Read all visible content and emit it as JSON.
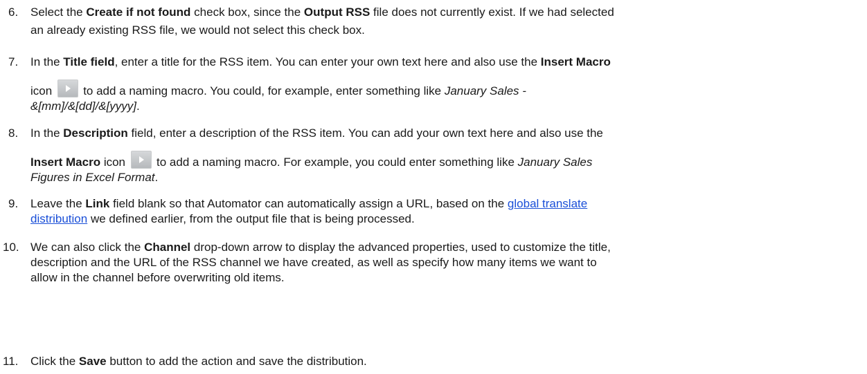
{
  "steps": [
    {
      "number": "6.",
      "t1": "Select the ",
      "b1": "Create if not found",
      "t2": " check box, since the ",
      "b2": "Output RSS",
      "t3": " file does not currently exist. If we had selected",
      "t4": "an already existing RSS file, we would not select this check box."
    },
    {
      "number": "7.",
      "t1": "In the ",
      "b1": "Title field",
      "t2": ", enter a title for the RSS item. You can enter your own text here and also use the ",
      "b2": "Insert Macro",
      "t3": "icon",
      "t4": "to add a naming macro. You could, for example, enter something like ",
      "i1": "January Sales -",
      "i2": "&[mm]/&[dd]/&[yyyy]",
      "t5": "."
    },
    {
      "number": "8.",
      "t1": "In the ",
      "b1": "Description",
      "t2": " field, enter a description of the RSS item. You can add your own text here and also use the",
      "b2": "Insert Macro",
      "t3": " icon",
      "t4": "to add a naming macro. For example, you could enter something like ",
      "i1": "January Sales",
      "i2": "Figures in Excel Format",
      "t5": "."
    },
    {
      "number": "9.",
      "t1": "Leave the ",
      "b1": "Link",
      "t2": " field blank so that Automator can automatically assign a URL, based on the ",
      "link1": "global translate",
      "link2": "distribution",
      "t3": " we defined earlier, from the output file that is being processed."
    },
    {
      "number": "10.",
      "t1": "We can also click the ",
      "b1": "Channel",
      "t2": " drop-down arrow to display the advanced properties, used to customize the title,",
      "t3": "description and the URL of the RSS channel we have created, as well as specify how many items we want to",
      "t4": "allow in the channel before overwriting old items."
    },
    {
      "number": "11.",
      "t1": "Click the ",
      "b1": "Save",
      "t2": " button to add the action and save the distribution."
    }
  ],
  "icons": {
    "insert_macro": "insert-macro-icon"
  },
  "colors": {
    "link": "#1a4fd8",
    "icon_bg": "#c4c6c8"
  }
}
